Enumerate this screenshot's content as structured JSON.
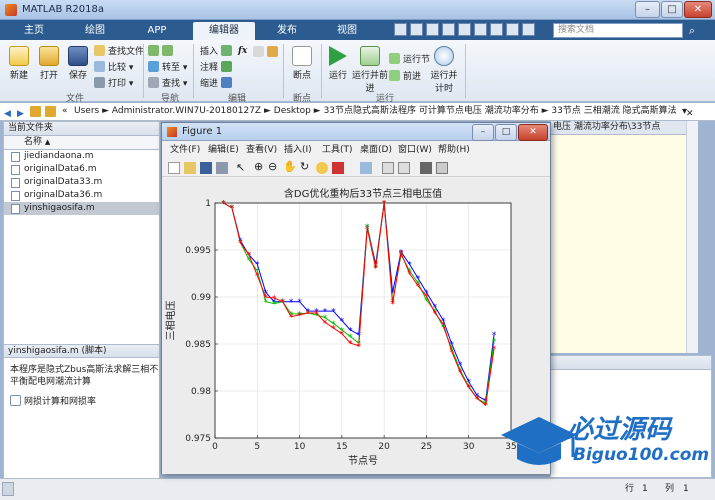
{
  "app": {
    "title": "MATLAB R2018a",
    "window_buttons": [
      "–",
      "□",
      "✕"
    ],
    "tabs": [
      "主页",
      "绘图",
      "APP",
      "编辑器",
      "发布",
      "视图"
    ],
    "active_tab": "编辑器",
    "search_placeholder": "搜索文档"
  },
  "ribbon": {
    "file_group": {
      "label": "文件",
      "new": "新建",
      "open": "打开",
      "save": "保存",
      "find_file": "查找文件",
      "compare": "比较",
      "print": "打印"
    },
    "nav_group": {
      "label": "导航",
      "goto": "转至",
      "find": "查找"
    },
    "edit_group": {
      "label": "编辑",
      "insert": "插入",
      "comment": "注释",
      "indent": "缩进",
      "fx": "fx"
    },
    "breakpoint_group": {
      "label": "断点",
      "breakpoint": "断点"
    },
    "run_group": {
      "label": "运行",
      "run": "运行",
      "run_advance": "运行并前进",
      "run_section": "运行节",
      "advance": "前进",
      "run_time": "运行并计时"
    }
  },
  "path": {
    "segments": [
      "Users",
      "Administrator.WIN7U-20180127Z",
      "Desktop",
      "33节点隐式高斯法程序 可计算节点电压 潮流功率分布",
      "33节点 三相潮流 隐式高斯算法"
    ],
    "separator": "►"
  },
  "left_panel": {
    "title": "当前文件夹",
    "column": "名称",
    "sort": "▲",
    "files": [
      "jiediandaona.m",
      "originalData6.m",
      "originalData33.m",
      "originalData36.m",
      "yinshigaosifa.m"
    ],
    "selected_index": 4,
    "details_title": "yinshigaosifa.m (脚本)",
    "details_text": "本程序是隐式Zbus高斯法求解三相不平衡配电网潮流计算",
    "details_item": "网损计算和网损率"
  },
  "editor_bg_text": "电压 潮流功率分布\\33节点",
  "figure": {
    "title": "Figure 1",
    "menu": [
      "文件(F)",
      "编辑(E)",
      "查看(V)",
      "插入(I)",
      "工具(T)",
      "桌面(D)",
      "窗口(W)",
      "帮助(H)"
    ]
  },
  "status": {
    "row_label": "行",
    "row": "1",
    "col_label": "列",
    "col": "1"
  },
  "watermark": {
    "brand": "必过源码",
    "url": "Biguo100.com"
  },
  "chart_data": {
    "type": "line",
    "title": "含DG优化重构后33节点三相电压值",
    "xlabel": "节点号",
    "ylabel": "三相电压",
    "xlim": [
      0,
      35
    ],
    "ylim": [
      0.975,
      1
    ],
    "xticks": [
      0,
      5,
      10,
      15,
      20,
      25,
      30,
      35
    ],
    "yticks": [
      0.975,
      0.98,
      0.985,
      0.99,
      0.995,
      1
    ],
    "grid": true,
    "x": [
      1,
      2,
      3,
      4,
      5,
      6,
      7,
      8,
      9,
      10,
      11,
      12,
      13,
      14,
      15,
      16,
      17,
      18,
      19,
      20,
      21,
      22,
      23,
      24,
      25,
      26,
      27,
      28,
      29,
      30,
      31,
      32,
      33
    ],
    "series": [
      {
        "color": "#0000ff",
        "marker": "*",
        "values": [
          1.0,
          0.9995,
          0.996,
          0.9945,
          0.9935,
          0.9905,
          0.9895,
          0.9895,
          0.9895,
          0.9895,
          0.9885,
          0.9885,
          0.9885,
          0.9885,
          0.9875,
          0.9865,
          0.986,
          0.9975,
          0.9935,
          1.0,
          0.9905,
          0.9948,
          0.9935,
          0.992,
          0.9905,
          0.989,
          0.9875,
          0.985,
          0.9828,
          0.981,
          0.9795,
          0.979,
          0.986
        ]
      },
      {
        "color": "#00c000",
        "marker": "*",
        "values": [
          1.0,
          0.9995,
          0.9958,
          0.994,
          0.9928,
          0.9895,
          0.9893,
          0.9895,
          0.9882,
          0.9882,
          0.9883,
          0.9881,
          0.9878,
          0.9872,
          0.9865,
          0.9858,
          0.9851,
          0.9975,
          0.9932,
          1.0,
          0.9895,
          0.9945,
          0.9928,
          0.9915,
          0.9897,
          0.9885,
          0.9868,
          0.9845,
          0.9822,
          0.9805,
          0.9792,
          0.9787,
          0.9853
        ]
      },
      {
        "color": "#ff0000",
        "marker": "*",
        "values": [
          1.0,
          0.9995,
          0.9958,
          0.9945,
          0.9923,
          0.99,
          0.9899,
          0.9895,
          0.9879,
          0.9881,
          0.9883,
          0.9883,
          0.9873,
          0.9867,
          0.9861,
          0.9851,
          0.9848,
          0.9973,
          0.9931,
          1.0,
          0.9893,
          0.9947,
          0.9925,
          0.9912,
          0.9901,
          0.9883,
          0.9871,
          0.9842,
          0.982,
          0.9804,
          0.9792,
          0.9785,
          0.9845
        ]
      }
    ]
  }
}
